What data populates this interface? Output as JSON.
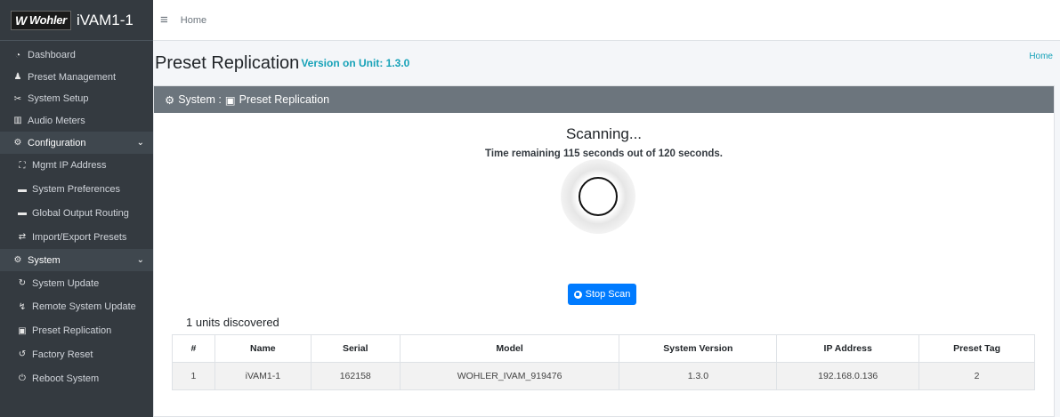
{
  "brand": {
    "logo": "Wohler",
    "title": "iVAM1-1"
  },
  "topbar": {
    "home": "Home"
  },
  "sidebar": {
    "items": [
      {
        "label": "Dashboard",
        "icon": "dashboard-icon",
        "glyph": "◔"
      },
      {
        "label": "Preset Management",
        "icon": "user-icon",
        "glyph": "👤"
      },
      {
        "label": "System Setup",
        "icon": "tools-icon",
        "glyph": "✂"
      },
      {
        "label": "Audio Meters",
        "icon": "meter-icon",
        "glyph": "▥"
      }
    ],
    "configuration": {
      "label": "Configuration",
      "items": [
        {
          "label": "Mgmt IP Address",
          "icon": "network-icon",
          "glyph": "⛶"
        },
        {
          "label": "System Preferences",
          "icon": "display-icon",
          "glyph": "▬"
        },
        {
          "label": "Global Output Routing",
          "icon": "routing-icon",
          "glyph": "▬"
        },
        {
          "label": "Import/Export Presets",
          "icon": "exchange-icon",
          "glyph": "⇄"
        }
      ]
    },
    "system": {
      "label": "System",
      "items": [
        {
          "label": "System Update",
          "icon": "refresh-icon",
          "glyph": "↻"
        },
        {
          "label": "Remote System Update",
          "icon": "satellite-icon",
          "glyph": "↯"
        },
        {
          "label": "Preset Replication",
          "icon": "clone-icon",
          "glyph": "▣"
        },
        {
          "label": "Factory Reset",
          "icon": "undo-icon",
          "glyph": "↺"
        },
        {
          "label": "Reboot System",
          "icon": "power-icon",
          "glyph": "⏻"
        }
      ]
    }
  },
  "page": {
    "title": "Preset Replication",
    "version": "Version on Unit: 1.3.0",
    "breadcrumb": "Home"
  },
  "card": {
    "header_system": "System :",
    "header_page": "Preset Replication",
    "scan_title": "Scanning...",
    "scan_time": "Time remaining 115 seconds out of 120 seconds.",
    "stop_label": "Stop Scan",
    "discovered": "1 units discovered"
  },
  "table": {
    "headers": [
      "#",
      "Name",
      "Serial",
      "Model",
      "System Version",
      "IP Address",
      "Preset Tag"
    ],
    "rows": [
      [
        "1",
        "iVAM1-1",
        "162158",
        "WOHLER_IVAM_919476",
        "1.3.0",
        "192.168.0.136",
        "2"
      ]
    ]
  },
  "colors": {
    "sidebar": "#343a40",
    "accent": "#17a2b8",
    "primary": "#007bff",
    "card_header": "#6c757d"
  }
}
